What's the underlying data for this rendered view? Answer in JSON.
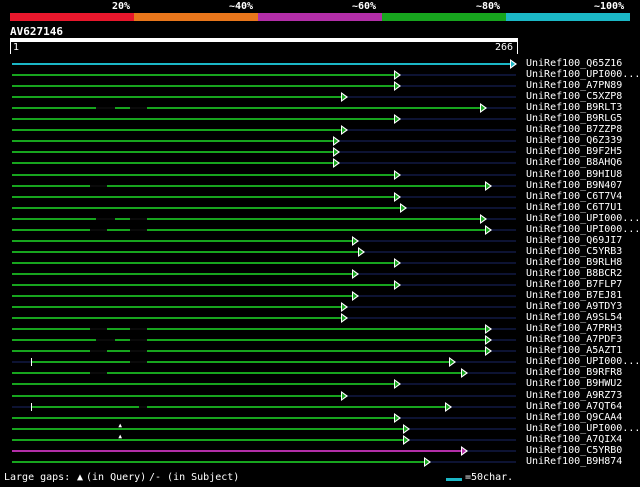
{
  "colors": {
    "background": "#000000",
    "track": "#0d1333",
    "red": "#e8172c",
    "orange": "#e8761b",
    "purple": "#b32ea8",
    "green": "#17a51e",
    "cyan": "#1bb7c6",
    "text": "#ffffff"
  },
  "identity_scale": {
    "labels": [
      "20%",
      "~40%",
      "~60%",
      "~80%",
      "~100%"
    ],
    "bands": [
      "red",
      "orange",
      "purple",
      "green",
      "cyan"
    ]
  },
  "query": {
    "id": "AV627146",
    "start": "1",
    "end": "266"
  },
  "hits": [
    {
      "label": "UniRef100_Q65Z16",
      "color": "cyan",
      "start": 1,
      "end": 266
    },
    {
      "label": "UniRef100_UPI000...",
      "color": "green",
      "start": 1,
      "end": 205
    },
    {
      "label": "UniRef100_A7PN89",
      "color": "green",
      "start": 1,
      "end": 205
    },
    {
      "label": "UniRef100_C5XZP8",
      "color": "green",
      "start": 1,
      "end": 177
    },
    {
      "label": "UniRef100_B9RLT3",
      "color": "green",
      "start": 1,
      "end": 250,
      "gaps": [
        [
          45,
          55
        ],
        [
          63,
          72
        ]
      ]
    },
    {
      "label": "UniRef100_B9RLG5",
      "color": "green",
      "start": 1,
      "end": 205
    },
    {
      "label": "UniRef100_B7ZZP8",
      "color": "green",
      "start": 1,
      "end": 177
    },
    {
      "label": "UniRef100_Q6Z339",
      "color": "green",
      "start": 1,
      "end": 173
    },
    {
      "label": "UniRef100_B9F2H5",
      "color": "green",
      "start": 1,
      "end": 173
    },
    {
      "label": "UniRef100_B8AHQ6",
      "color": "green",
      "start": 1,
      "end": 173
    },
    {
      "label": "UniRef100_B9HIU8",
      "color": "green",
      "start": 1,
      "end": 205
    },
    {
      "label": "UniRef100_B9N407",
      "color": "green",
      "start": 1,
      "end": 253,
      "gaps": [
        [
          42,
          51
        ]
      ]
    },
    {
      "label": "UniRef100_C6T7V4",
      "color": "green",
      "start": 1,
      "end": 205
    },
    {
      "label": "UniRef100_C6T7U1",
      "color": "green",
      "start": 1,
      "end": 208
    },
    {
      "label": "UniRef100_UPI000...",
      "color": "green",
      "start": 1,
      "end": 250,
      "gaps": [
        [
          45,
          55
        ],
        [
          63,
          72
        ]
      ]
    },
    {
      "label": "UniRef100_UPI000...",
      "color": "green",
      "start": 1,
      "end": 253,
      "gaps": [
        [
          42,
          51
        ],
        [
          63,
          72
        ]
      ]
    },
    {
      "label": "UniRef100_Q69JI7",
      "color": "green",
      "start": 1,
      "end": 183
    },
    {
      "label": "UniRef100_C5YRB3",
      "color": "green",
      "start": 1,
      "end": 186
    },
    {
      "label": "UniRef100_B9RLH8",
      "color": "green",
      "start": 1,
      "end": 205
    },
    {
      "label": "UniRef100_B8BCR2",
      "color": "green",
      "start": 1,
      "end": 183
    },
    {
      "label": "UniRef100_B7FLP7",
      "color": "green",
      "start": 1,
      "end": 205
    },
    {
      "label": "UniRef100_B7EJ81",
      "color": "green",
      "start": 1,
      "end": 183
    },
    {
      "label": "UniRef100_A9TDY3",
      "color": "green",
      "start": 1,
      "end": 177
    },
    {
      "label": "UniRef100_A9SL54",
      "color": "green",
      "start": 1,
      "end": 177
    },
    {
      "label": "UniRef100_A7PRH3",
      "color": "green",
      "start": 1,
      "end": 253,
      "gaps": [
        [
          42,
          51
        ],
        [
          63,
          72
        ]
      ]
    },
    {
      "label": "UniRef100_A7PDF3",
      "color": "green",
      "start": 1,
      "end": 253,
      "gaps": [
        [
          45,
          55
        ],
        [
          63,
          72
        ]
      ]
    },
    {
      "label": "UniRef100_A5AZT1",
      "color": "green",
      "start": 1,
      "end": 253,
      "gaps": [
        [
          42,
          51
        ],
        [
          63,
          72
        ]
      ]
    },
    {
      "label": "UniRef100_UPI000...",
      "color": "green",
      "start": 11,
      "end": 234,
      "gaps": [
        [
          63,
          72
        ]
      ]
    },
    {
      "label": "UniRef100_B9RFR8",
      "color": "green",
      "start": 1,
      "end": 240,
      "gaps": [
        [
          42,
          51
        ]
      ]
    },
    {
      "label": "UniRef100_B9HWU2",
      "color": "green",
      "start": 1,
      "end": 205
    },
    {
      "label": "UniRef100_A9RZ73",
      "color": "green",
      "start": 1,
      "end": 177
    },
    {
      "label": "UniRef100_A7QT64",
      "color": "green",
      "start": 11,
      "end": 232,
      "gaps": [
        [
          68,
          72
        ]
      ]
    },
    {
      "label": "UniRef100_Q9CAA4",
      "color": "green",
      "start": 1,
      "end": 205
    },
    {
      "label": "UniRef100_UPI000...",
      "color": "green",
      "start": 1,
      "end": 210,
      "marks": [
        58
      ]
    },
    {
      "label": "UniRef100_A7QIX4",
      "color": "green",
      "start": 1,
      "end": 210,
      "marks": [
        58
      ]
    },
    {
      "label": "UniRef100_C5YRB0",
      "color": "purple",
      "start": 1,
      "end": 240
    },
    {
      "label": "UniRef100_B9H874",
      "color": "green",
      "start": 1,
      "end": 221
    }
  ],
  "legend": {
    "large_gaps": "Large gaps:",
    "in_query": "(in Query)",
    "in_subject": "/- (in Subject)",
    "scale": "=50char."
  }
}
